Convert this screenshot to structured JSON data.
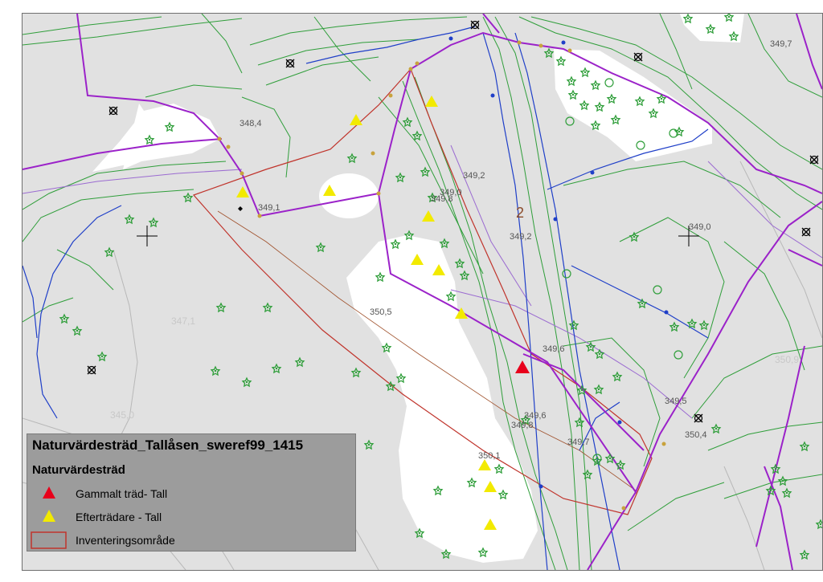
{
  "map": {
    "spot_heights": [
      "349,7",
      "348,4",
      "349,2",
      "349,0",
      "349,8",
      "349,1",
      "349,2",
      "349,0",
      "350,5",
      "347,1",
      "349,6",
      "350,9",
      "345,0",
      "349,5",
      "349,6",
      "349,8",
      "350,4",
      "349,7",
      "350,1"
    ],
    "area_number": "2",
    "colors": {
      "background": "#e1e1e1",
      "open_area": "#ffffff",
      "property_line": "#9b22c9",
      "building_line": "#2f9e3a",
      "water_line": "#1f3fc8",
      "inventory_boundary": "#c0342c",
      "old_tree": "#e8001b",
      "successor_tree": "#f2ea00"
    },
    "symbols": {
      "old_tree": "red-triangle-icon",
      "successor_tree": "yellow-triangle-icon",
      "bush": "green-star-icon",
      "well": "well-x-icon",
      "survey_point": "crosshair-icon"
    }
  },
  "legend": {
    "title": "Naturvärdesträd_Tallåsen_sweref99_1415",
    "subtitle": "Naturvärdesträd",
    "items": [
      {
        "label": "Gammalt träd- Tall",
        "symbol": "red-triangle-icon",
        "color": "#e8001b"
      },
      {
        "label": "Efterträdare - Tall",
        "symbol": "yellow-triangle-icon",
        "color": "#f2ea00"
      },
      {
        "label": "Inventeringsområde",
        "symbol": "inventory-area-icon",
        "color": "#c0342c"
      }
    ]
  }
}
